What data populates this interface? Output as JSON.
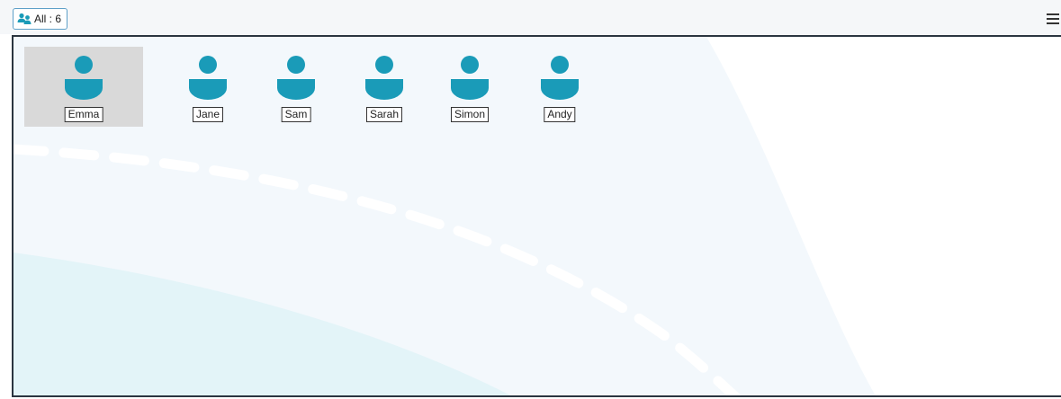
{
  "toolbar": {
    "filter_label": "All : 6",
    "filter_icon": "people-group-icon",
    "menu_icon": "hamburger-menu-icon"
  },
  "people": [
    {
      "name": "Emma",
      "selected": true
    },
    {
      "name": "Jane",
      "selected": false
    },
    {
      "name": "Sam",
      "selected": false
    },
    {
      "name": "Sarah",
      "selected": false
    },
    {
      "name": "Simon",
      "selected": false
    },
    {
      "name": "Andy",
      "selected": false
    }
  ],
  "colors": {
    "avatar": "#1a9bb8",
    "selected_bg": "#d9d9d9",
    "canvas_border": "#2b3540",
    "badge_border": "#5ea0c8"
  }
}
